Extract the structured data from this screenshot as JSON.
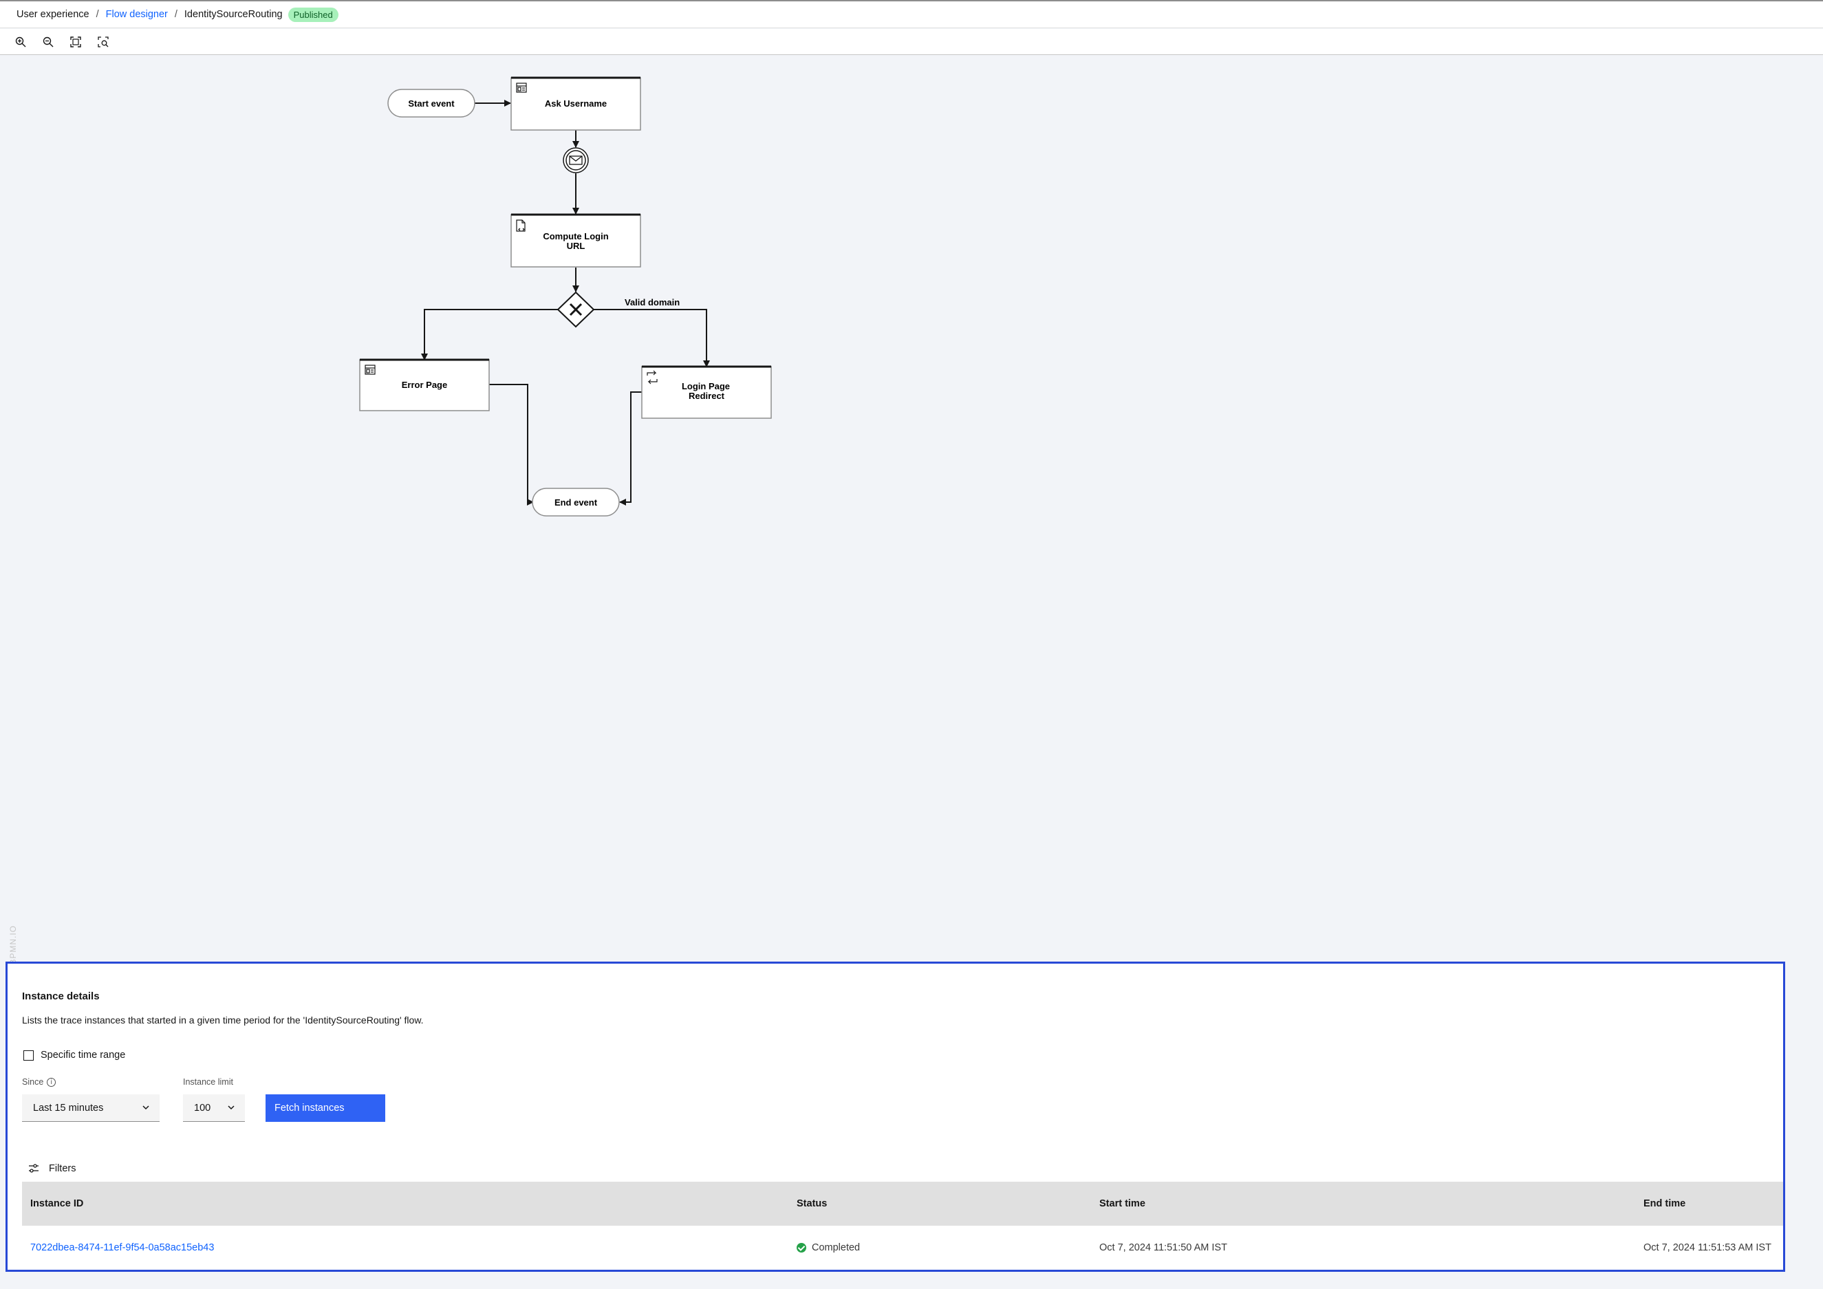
{
  "breadcrumb": {
    "items": [
      "User experience",
      "Flow designer",
      "IdentitySourceRouting"
    ],
    "separator": "/",
    "badge": "Published"
  },
  "toolbar": {
    "icons": [
      "zoom-in-icon",
      "zoom-out-icon",
      "fit-to-screen-icon",
      "zoom-area-icon"
    ]
  },
  "diagram": {
    "start": "Start event",
    "ask_username": "Ask Username",
    "compute_line1": "Compute Login",
    "compute_line2": "URL",
    "gateway_label": "Valid domain",
    "error_page": "Error Page",
    "login_line1": "Login Page",
    "login_line2": "Redirect",
    "end": "End event",
    "watermark": "BPMN.IO"
  },
  "instance_panel": {
    "title": "Instance details",
    "description": "Lists the trace instances that started in a given time period for the 'IdentitySourceRouting' flow.",
    "specific_range_label": "Specific time range",
    "since_label": "Since",
    "since_value": "Last 15 minutes",
    "limit_label": "Instance limit",
    "limit_value": "100",
    "fetch_button": "Fetch instances",
    "filters_label": "Filters",
    "columns": [
      "Instance ID",
      "Status",
      "Start time",
      "End time"
    ],
    "rows": [
      {
        "id": "7022dbea-8474-11ef-9f54-0a58ac15eb43",
        "status": "Completed",
        "start": "Oct 7, 2024 11:51:50 AM IST",
        "end": "Oct 7, 2024 11:51:53 AM IST"
      }
    ]
  },
  "colors": {
    "accent": "#0f62fe",
    "panel_border": "#2849d6",
    "success": "#24a148",
    "badge_bg": "#a7f0ba"
  }
}
